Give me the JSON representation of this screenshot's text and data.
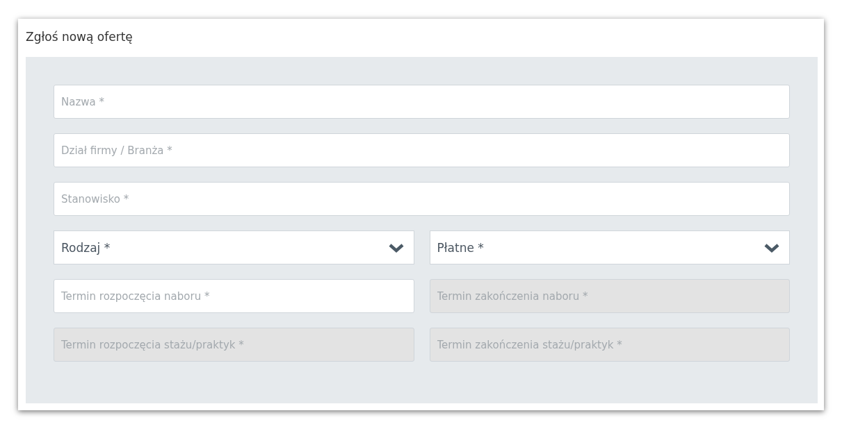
{
  "panel": {
    "title": "Zgłoś nową ofertę"
  },
  "form": {
    "rows": [
      [
        {
          "kind": "text",
          "placeholder": "Nazwa *",
          "disabled": false
        }
      ],
      [
        {
          "kind": "text",
          "placeholder": "Dział firmy / Branża *",
          "disabled": false
        }
      ],
      [
        {
          "kind": "text",
          "placeholder": "Stanowisko *",
          "disabled": false
        }
      ],
      [
        {
          "kind": "select",
          "value": "Rodzaj *",
          "disabled": false
        },
        {
          "kind": "select",
          "value": "Płatne *",
          "disabled": false
        }
      ],
      [
        {
          "kind": "text",
          "placeholder": "Termin rozpoczęcia naboru *",
          "disabled": false
        },
        {
          "kind": "text",
          "placeholder": "Termin zakończenia naboru *",
          "disabled": true
        }
      ],
      [
        {
          "kind": "text",
          "placeholder": "Termin rozpoczęcia stażu/praktyk *",
          "disabled": true
        },
        {
          "kind": "text",
          "placeholder": "Termin zakończenia stażu/praktyk *",
          "disabled": true
        }
      ]
    ]
  }
}
